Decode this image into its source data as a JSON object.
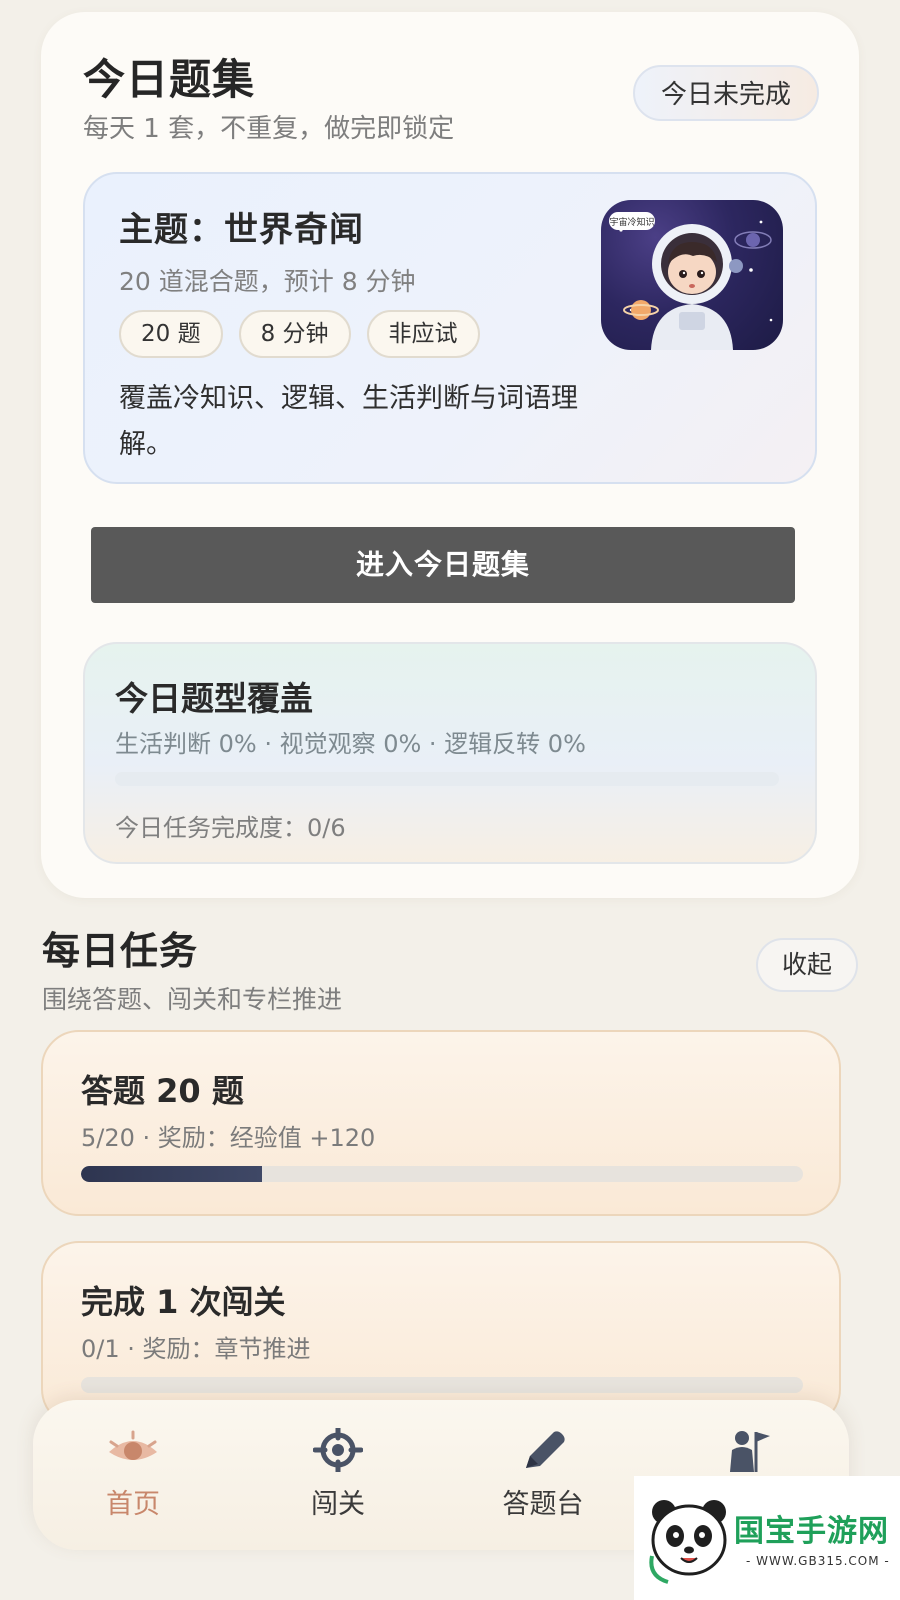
{
  "today": {
    "title": "今日题集",
    "subtitle": "每天 1 套，不重复，做完即锁定",
    "status": "今日未完成",
    "theme": {
      "title": "主题：世界奇闻",
      "description": "20 道混合题，预计 8 分钟",
      "chips": [
        "20 题",
        "8 分钟",
        "非应试"
      ],
      "body": "覆盖冷知识、逻辑、生活判断与词语理解。",
      "image_bubble": "宇宙冷知识"
    },
    "enter_label": "进入今日题集",
    "coverage": {
      "title": "今日题型覆盖",
      "stats": "生活判断 0% · 视觉观察 0% · 逻辑反转 0%",
      "fill_fraction": 0,
      "progress": "今日任务完成度：0/6"
    }
  },
  "tasks": {
    "title": "每日任务",
    "subtitle": "围绕答题、闯关和专栏推进",
    "collapse_label": "收起",
    "items": [
      {
        "name": "答题 20 题",
        "meta": "5/20 · 奖励：经验值 +120",
        "progress": 0.25
      },
      {
        "name": "完成 1 次闯关",
        "meta": "0/1 · 奖励：章节推进",
        "progress": 0
      }
    ]
  },
  "nav": {
    "items": [
      {
        "label": "首页",
        "icon": "eye-icon",
        "active": true
      },
      {
        "label": "闯关",
        "icon": "crosshair-icon",
        "active": false
      },
      {
        "label": "答题台",
        "icon": "pencil-icon",
        "active": false
      },
      {
        "label": "",
        "icon": "person-flag-icon",
        "active": false
      }
    ]
  },
  "watermark": {
    "text": "国宝手游网",
    "url": "- WWW.GB315.COM -"
  },
  "colors": {
    "accent_active": "#c8876b",
    "button_dark": "#595959",
    "progress_fill": "#2e3550",
    "watermark_green": "#1fa05a"
  }
}
